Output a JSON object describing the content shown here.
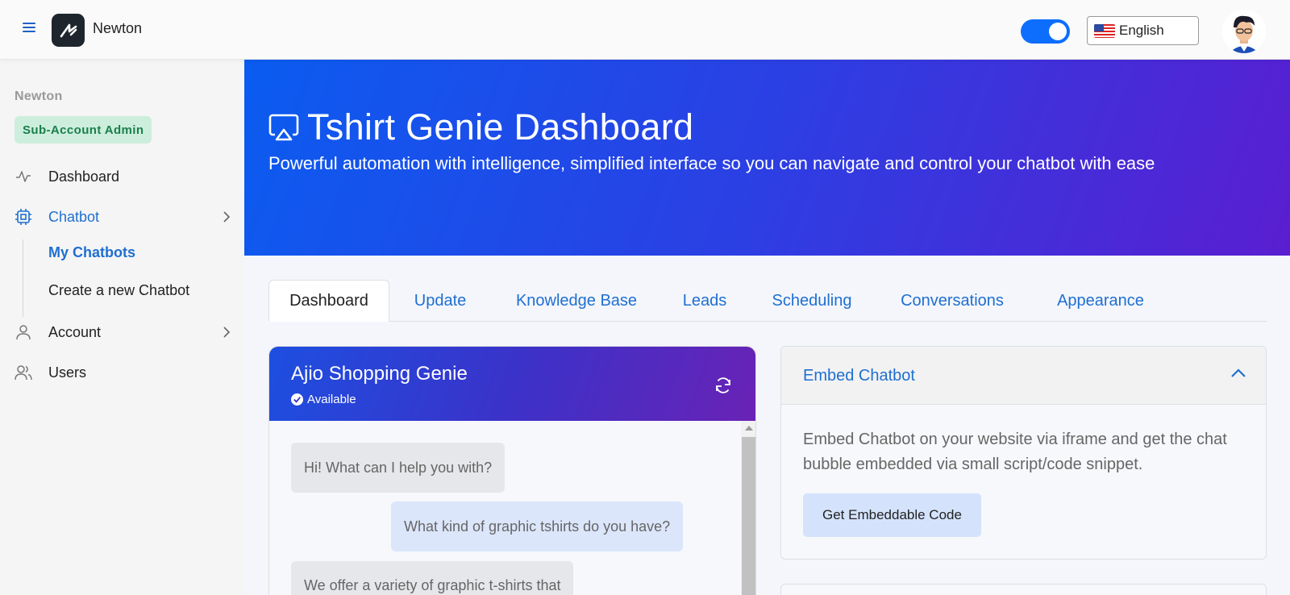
{
  "header": {
    "brand": "Newton",
    "language": "English"
  },
  "sidebar": {
    "org_label": "Newton",
    "role_badge": "Sub-Account Admin",
    "items": [
      {
        "label": "Dashboard",
        "icon": "activity-icon"
      },
      {
        "label": "Chatbot",
        "icon": "cpu-icon"
      },
      {
        "label": "Account",
        "icon": "user-icon"
      },
      {
        "label": "Users",
        "icon": "users-icon"
      }
    ],
    "chatbot_submenu": [
      "My Chatbots",
      "Create a new Chatbot"
    ]
  },
  "hero": {
    "title": "Tshirt Genie Dashboard",
    "subtitle": "Powerful automation with intelligence, simplified interface so you can navigate and control your chatbot with ease"
  },
  "tabs": [
    "Dashboard",
    "Update",
    "Knowledge Base",
    "Leads",
    "Scheduling",
    "Conversations",
    "Appearance"
  ],
  "chat": {
    "name": "Ajio Shopping Genie",
    "status": "Available",
    "messages": [
      {
        "from": "bot",
        "text": "Hi! What can I help you with?"
      },
      {
        "from": "user",
        "text": "What kind of graphic tshirts do you have?"
      },
      {
        "from": "bot",
        "text": "We offer a variety of graphic t-shirts that"
      }
    ]
  },
  "embed": {
    "title": "Embed Chatbot",
    "description": "Embed Chatbot on your website via iframe and get the chat bubble embedded via small script/code snippet.",
    "button": "Get Embeddable Code"
  },
  "colors": {
    "accent": "#1f6fd0",
    "hero_start": "#0b5cf0",
    "hero_end": "#5a1ed0",
    "badge_bg": "#cdeedd",
    "badge_text": "#1a7f4b"
  }
}
